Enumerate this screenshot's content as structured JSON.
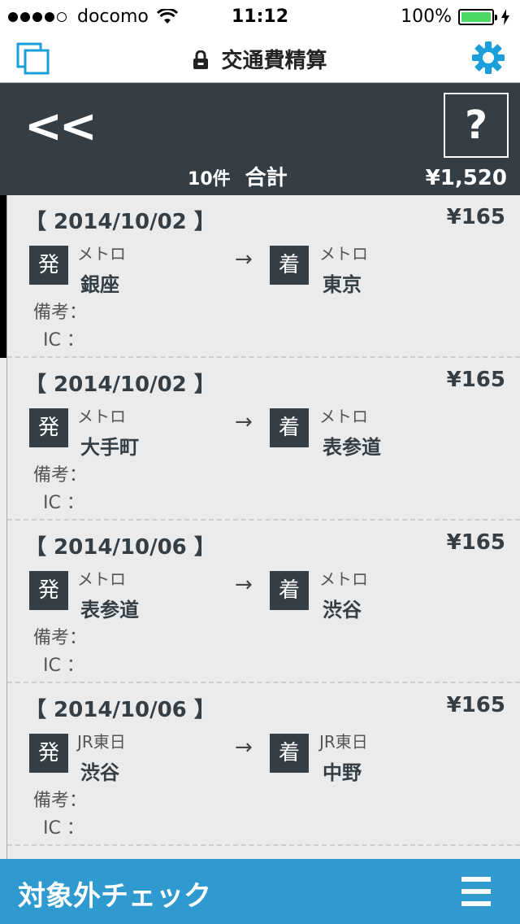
{
  "status_bar": {
    "carrier": "docomo",
    "time": "11:12",
    "battery": "100%",
    "battery_level": 1.0
  },
  "nav": {
    "title": "交通費精算",
    "left_icon": "copy-icon",
    "right_icon": "gear-icon",
    "accent_color": "#1a9fdc"
  },
  "summary": {
    "back_label": "<<",
    "help_label": "?",
    "count": "10件",
    "total_label": "合計",
    "total": "¥1,520"
  },
  "entries": [
    {
      "date": "【  2014/10/02  】",
      "price": "¥165",
      "dep_badge": "発",
      "dep_line": "メトロ",
      "dep_station": "銀座",
      "arrow": "→",
      "arr_badge": "着",
      "arr_line": "メトロ",
      "arr_station": "東京",
      "memo_label": "備考：",
      "ic_label": "IC  ："
    },
    {
      "date": "【  2014/10/02  】",
      "price": "¥165",
      "dep_badge": "発",
      "dep_line": "メトロ",
      "dep_station": "大手町",
      "arrow": "→",
      "arr_badge": "着",
      "arr_line": "メトロ",
      "arr_station": "表参道",
      "memo_label": "備考：",
      "ic_label": "IC  ："
    },
    {
      "date": "【  2014/10/06  】",
      "price": "¥165",
      "dep_badge": "発",
      "dep_line": "メトロ",
      "dep_station": "表参道",
      "arrow": "→",
      "arr_badge": "着",
      "arr_line": "メトロ",
      "arr_station": "渋谷",
      "memo_label": "備考：",
      "ic_label": "IC  ："
    },
    {
      "date": "【  2014/10/06  】",
      "price": "¥165",
      "dep_badge": "発",
      "dep_line": "JR東日",
      "dep_station": "渋谷",
      "arrow": "→",
      "arr_badge": "着",
      "arr_line": "JR東日",
      "arr_station": "中野",
      "memo_label": "備考：",
      "ic_label": "IC  ："
    }
  ],
  "bottom_bar": {
    "label": "対象外チェック",
    "icon": "menu-icon",
    "color": "#2f9ad0"
  }
}
